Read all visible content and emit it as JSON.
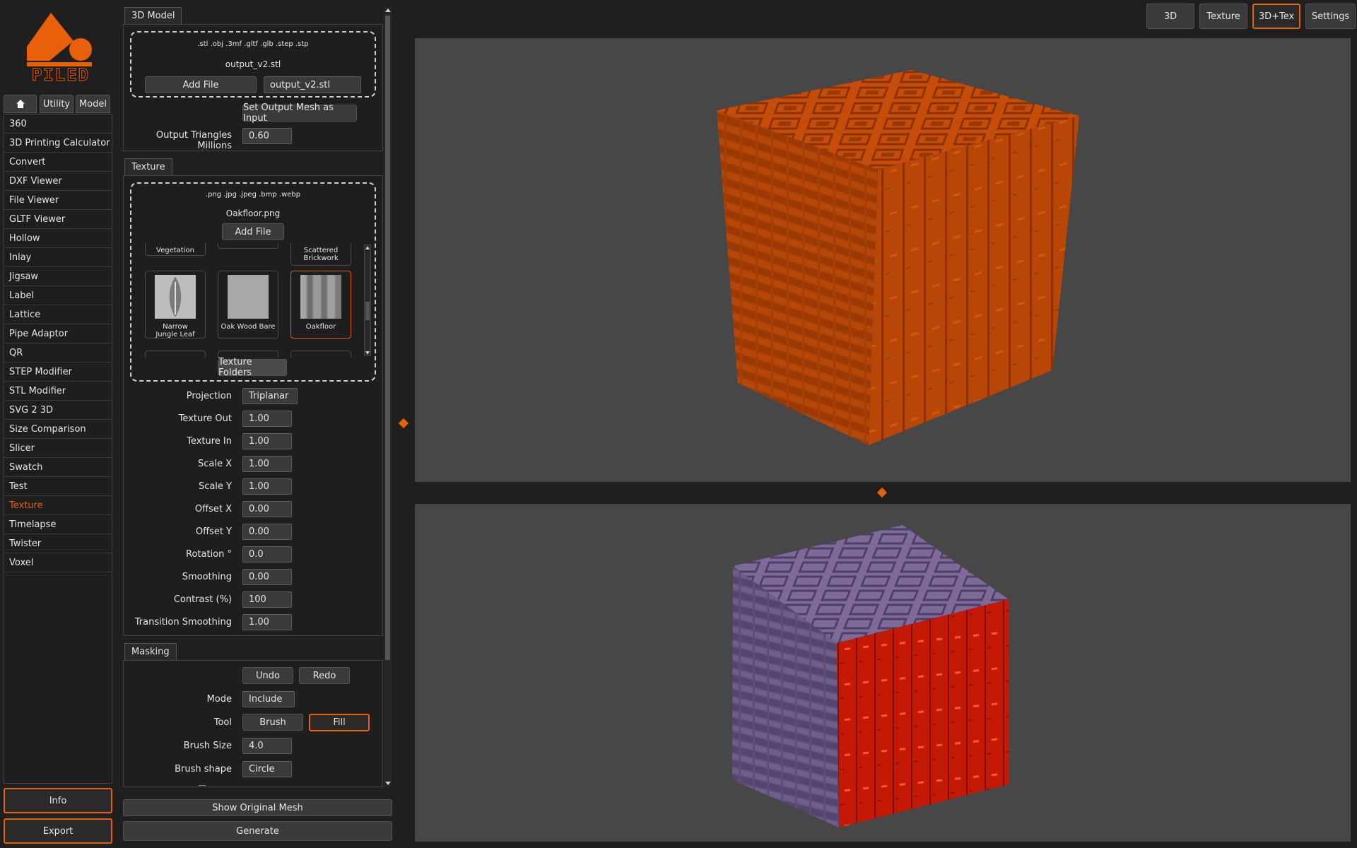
{
  "logo": {
    "text": "PILED",
    "color": "#e8600a"
  },
  "nav_tabs": {
    "home_icon": "home-icon",
    "utility": "Utility",
    "model": "Model"
  },
  "sidebar": {
    "items": [
      "360",
      "3D Printing Calculator",
      "Convert",
      "DXF Viewer",
      "File Viewer",
      "GLTF Viewer",
      "Hollow",
      "Inlay",
      "Jigsaw",
      "Label",
      "Lattice",
      "Pipe Adaptor",
      "QR",
      "STEP Modifier",
      "STL Modifier",
      "SVG 2 3D",
      "Size Comparison",
      "Slicer",
      "Swatch",
      "Test",
      "Texture",
      "Timelapse",
      "Twister",
      "Voxel"
    ],
    "active": "Texture"
  },
  "bottom_buttons": {
    "info": "Info",
    "export": "Export"
  },
  "model_section": {
    "tab": "3D Model",
    "extensions": ".stl  .obj  .3mf  .gltf  .glb  .step  .stp",
    "filename": "output_v2.stl",
    "add_file": "Add File",
    "file_select": "output_v2.stl",
    "set_output": "Set Output Mesh as Input",
    "triangles_label": "Output Triangles Millions",
    "triangles_value": "0.60"
  },
  "texture_section": {
    "tab": "Texture",
    "extensions": ".png  .jpg  .jpeg  .bmp  .webp",
    "filename": "Oakfloor.png",
    "add_file": "Add File",
    "tiles_top": [
      "Vegetation",
      "",
      "Scattered Brickwork"
    ],
    "tiles": [
      {
        "name": "Narrow Jungle Leaf"
      },
      {
        "name": "Oak Wood Bare"
      },
      {
        "name": "Oakfloor",
        "selected": true
      }
    ],
    "folders_button": "Texture Folders",
    "fields": [
      {
        "label": "Projection",
        "value": "Triplanar"
      },
      {
        "label": "Texture Out",
        "value": "1.00"
      },
      {
        "label": "Texture In",
        "value": "1.00"
      },
      {
        "label": "Scale X",
        "value": "1.00"
      },
      {
        "label": "Scale Y",
        "value": "1.00"
      },
      {
        "label": "Offset X",
        "value": "0.00"
      },
      {
        "label": "Offset Y",
        "value": "0.00"
      },
      {
        "label": "Rotation °",
        "value": "0.0"
      },
      {
        "label": "Smoothing",
        "value": "0.00"
      },
      {
        "label": "Contrast (%)",
        "value": "100"
      },
      {
        "label": "Transition Smoothing",
        "value": "1.00"
      }
    ]
  },
  "masking_section": {
    "tab": "Masking",
    "undo": "Undo",
    "redo": "Redo",
    "mode_label": "Mode",
    "mode_value": "Include",
    "tool_label": "Tool",
    "tool_brush": "Brush",
    "tool_fill": "Fill",
    "brush_size_label": "Brush Size",
    "brush_size_value": "4.0",
    "brush_shape_label": "Brush shape",
    "brush_shape_value": "Circle"
  },
  "action_buttons": {
    "show_original": "Show Original Mesh",
    "generate": "Generate"
  },
  "view_tabs": [
    "3D",
    "Texture",
    "3D+Tex",
    "Settings"
  ],
  "view_active": "3D+Tex",
  "colors": {
    "accent": "#e8600a",
    "viewport": "#474747",
    "cube_orange": "#c44a08",
    "cube_red": "#c41a05",
    "cube_purple": "#6e5c8a"
  }
}
